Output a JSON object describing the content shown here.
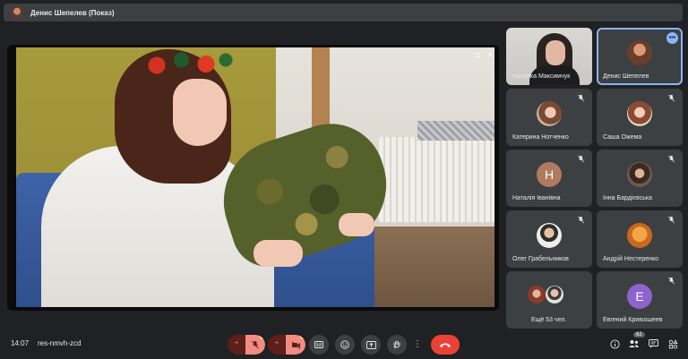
{
  "topbar": {
    "presenter_title": "Денис Шепелев (Показ)"
  },
  "participants": [
    {
      "name": "Наталка Максимчук",
      "mode": "camera",
      "muted": false,
      "active": false
    },
    {
      "name": "Денис Шепелев",
      "mode": "avatar-photo",
      "muted": false,
      "active": true
    },
    {
      "name": "Катерина Нотченко",
      "mode": "avatar-photo",
      "muted": true
    },
    {
      "name": "Саша Ожема",
      "mode": "avatar-photo",
      "muted": true
    },
    {
      "name": "Наталія Іванівна",
      "mode": "letter",
      "letter": "H",
      "letter_color": "#b07a5e",
      "muted": true
    },
    {
      "name": "Інна Бардієвська",
      "mode": "avatar-photo",
      "muted": true
    },
    {
      "name": "Олег Грабельников",
      "mode": "avatar-photo",
      "muted": true
    },
    {
      "name": "Андрій Нестеренко",
      "mode": "avatar-photo",
      "muted": true
    },
    {
      "name": "Ещё 53 чел.",
      "mode": "group",
      "muted": false
    },
    {
      "name": "Евгений Криюошеев",
      "mode": "letter",
      "letter": "E",
      "letter_color": "#8e63ce",
      "muted": true
    }
  ],
  "meeting": {
    "time": "14:07",
    "code": "res-nmvh-zcd"
  },
  "controls": {
    "mic_warning": "!",
    "cam_warning": "!",
    "participant_count": "62"
  },
  "colors": {
    "accent": "#8ab4f8",
    "end_call": "#ea4335",
    "muted_control": "#f28b82"
  }
}
